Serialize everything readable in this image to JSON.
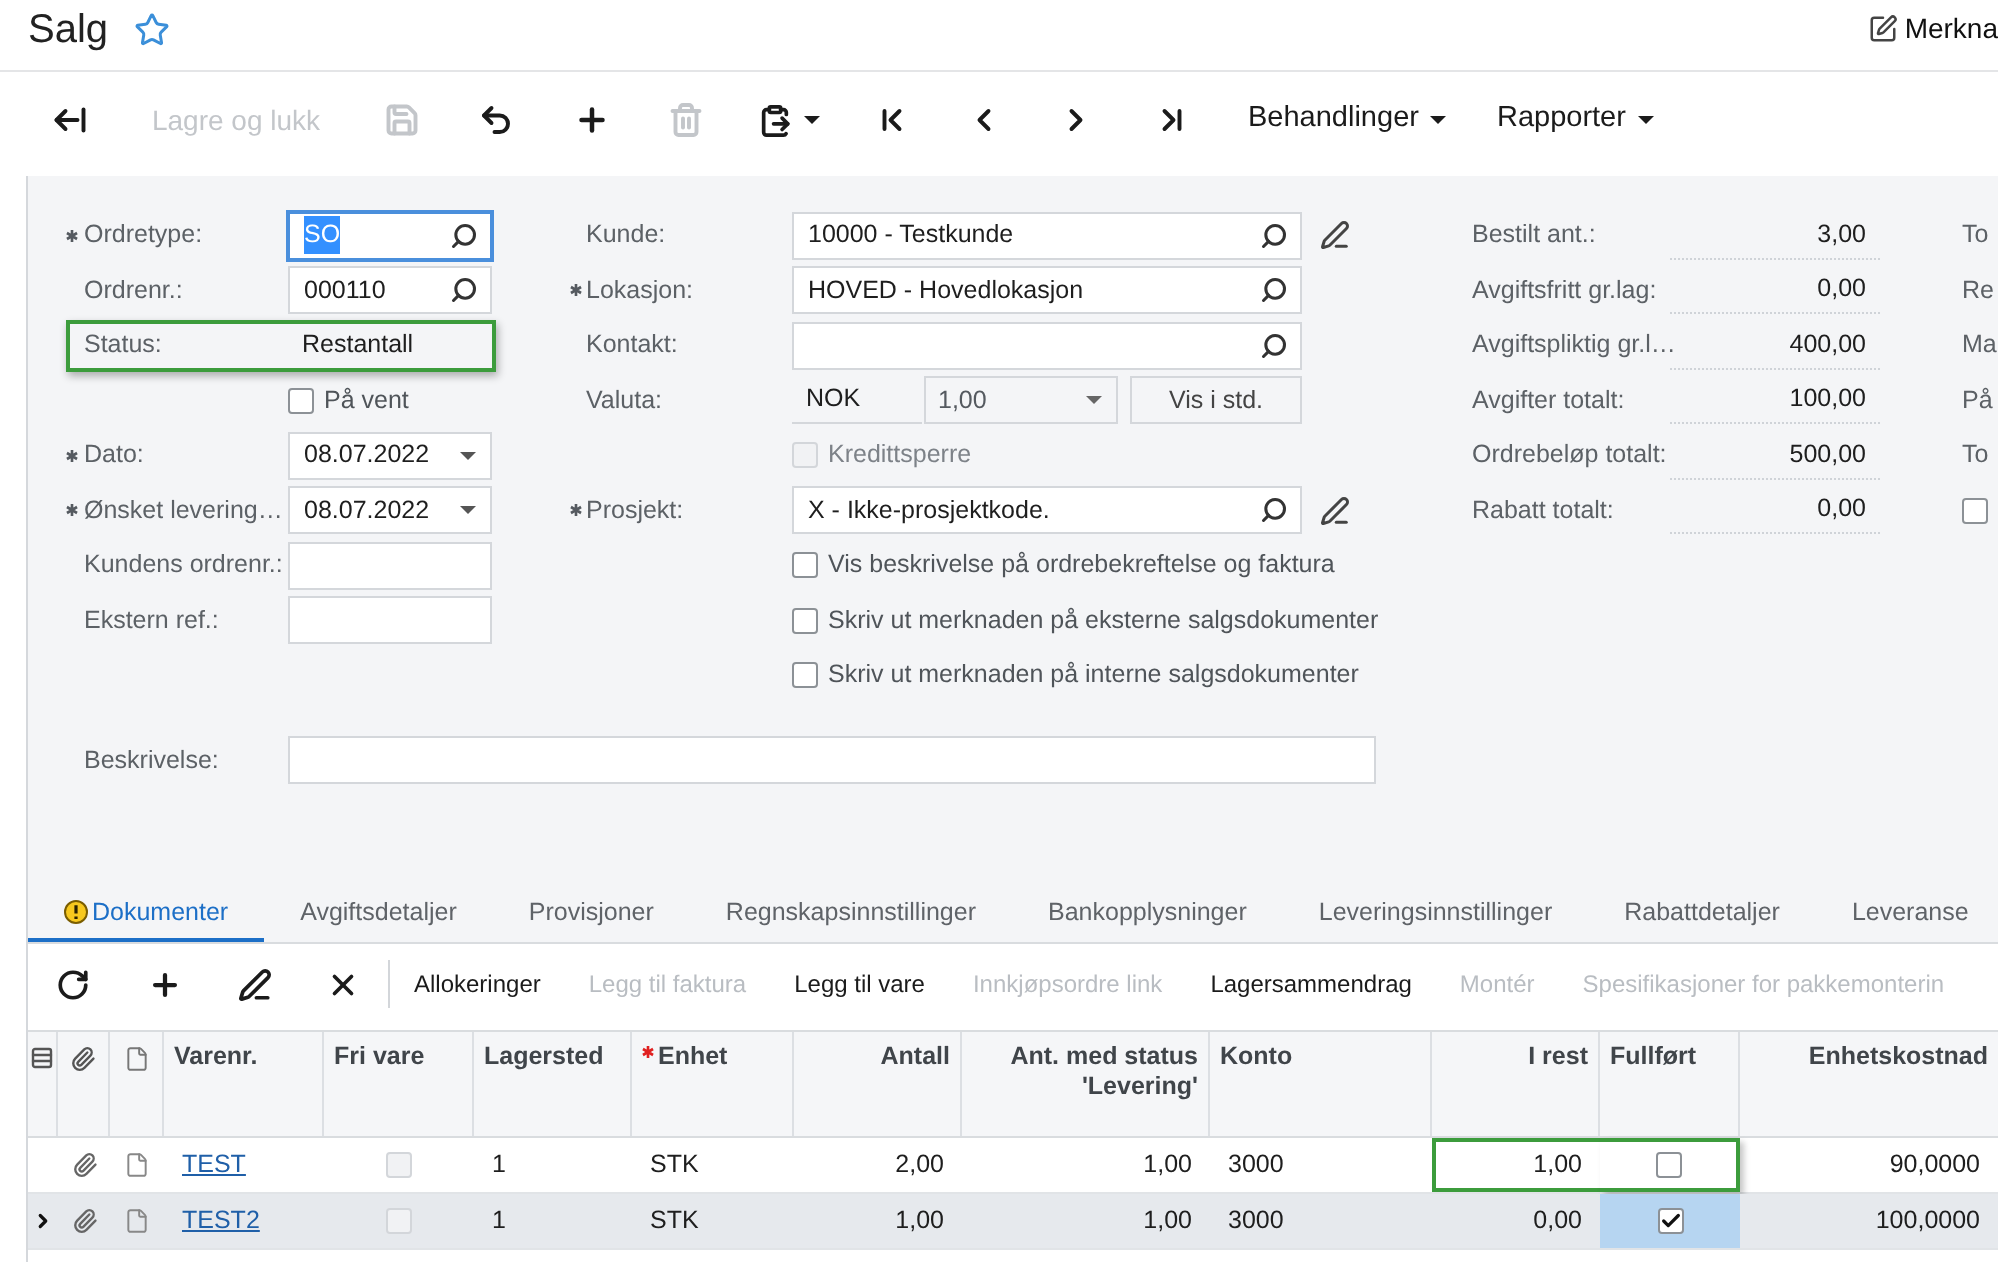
{
  "page": {
    "title": "Salg",
    "favorite": false,
    "notes_label": "Merkna"
  },
  "toolbar": [
    {
      "kind": "back",
      "disabled": false
    },
    {
      "kind": "text",
      "label": "Lagre og lukk",
      "disabled": true
    },
    {
      "kind": "save",
      "disabled": true
    },
    {
      "kind": "undo",
      "disabled": false
    },
    {
      "kind": "add",
      "disabled": false
    },
    {
      "kind": "delete",
      "disabled": true
    },
    {
      "kind": "paste",
      "disabled": false
    },
    {
      "kind": "first",
      "disabled": false
    },
    {
      "kind": "previous",
      "disabled": false
    },
    {
      "kind": "next",
      "disabled": false
    },
    {
      "kind": "last",
      "disabled": false
    },
    {
      "kind": "menu",
      "label": "Behandlinger",
      "disabled": false
    },
    {
      "kind": "menu",
      "label": "Rapporter",
      "disabled": false
    }
  ],
  "form": {
    "left": [
      {
        "kind": "lookup",
        "label": "Ordretype:",
        "required": true,
        "value": "SO",
        "focused": true,
        "highlighted": false
      },
      {
        "kind": "lookup",
        "label": "Ordrenr.:",
        "required": false,
        "value": "000110",
        "focused": false,
        "highlighted": false
      },
      {
        "kind": "readonly",
        "label": "Status:",
        "required": false,
        "value": "Restantall",
        "highlighted": true
      },
      {
        "kind": "checkbox",
        "label": "På vent",
        "checked": false,
        "disabled": false
      },
      {
        "kind": "date",
        "label": "Dato:",
        "required": true,
        "value": "08.07.2022",
        "focused": false,
        "highlighted": false
      },
      {
        "kind": "date",
        "label": "Ønsket levering…",
        "required": true,
        "value": "08.07.2022",
        "focused": false,
        "highlighted": false
      },
      {
        "kind": "text",
        "label": "Kundens ordrenr.:",
        "required": false,
        "focused": false,
        "highlighted": false
      },
      {
        "kind": "text",
        "label": "Ekstern ref.:",
        "required": false,
        "focused": false,
        "highlighted": false
      }
    ],
    "middle": [
      {
        "kind": "lookup",
        "label": "Kunde:",
        "required": false,
        "value": "10000 - Testkunde",
        "edit_button": true
      },
      {
        "kind": "lookup",
        "label": "Lokasjon:",
        "required": true,
        "value": "HOVED - Hovedlokasjon",
        "edit_button": false
      },
      {
        "kind": "lookup",
        "label": "Kontakt:",
        "required": false,
        "edit_button": false
      },
      {
        "kind": "currency",
        "label": "Valuta:",
        "required": false,
        "currency": "NOK",
        "rate": "1,00",
        "button": "Vis i std."
      },
      {
        "kind": "checkbox",
        "label": "Kredittsperre",
        "checked": false,
        "disabled": true
      },
      {
        "kind": "lookup",
        "label": "Prosjekt:",
        "required": true,
        "value": "X - Ikke-prosjektkode.",
        "edit_button": true
      },
      {
        "kind": "checkbox",
        "label": "Vis beskrivelse på ordrebekreftelse og faktura",
        "checked": false,
        "disabled": false
      },
      {
        "kind": "checkbox",
        "label": "Skriv ut merknaden på eksterne salgsdokumenter",
        "checked": false,
        "disabled": false
      },
      {
        "kind": "checkbox",
        "label": "Skriv ut merknaden på interne salgsdokumenter",
        "checked": false,
        "disabled": false
      }
    ],
    "totals": [
      {
        "label": "Bestilt ant.:",
        "value": "3,00"
      },
      {
        "label": "Avgiftsfritt gr.lag:",
        "value": "0,00"
      },
      {
        "label": "Avgiftspliktig gr.l…",
        "value": "400,00"
      },
      {
        "label": "Avgifter totalt:",
        "value": "100,00"
      },
      {
        "label": "Ordrebeløp totalt:",
        "value": "500,00"
      },
      {
        "label": "Rabatt totalt:",
        "value": "0,00"
      }
    ],
    "extra": [
      {
        "kind": "label",
        "label": "To"
      },
      {
        "kind": "label",
        "label": "Re"
      },
      {
        "kind": "label",
        "label": "Ma"
      },
      {
        "kind": "label",
        "label": "På"
      },
      {
        "kind": "label",
        "label": "To"
      },
      {
        "kind": "checkbox",
        "checked": false
      }
    ],
    "description": {
      "label": "Beskrivelse:"
    }
  },
  "tabs": [
    {
      "label": "Dokumenter",
      "selected": true,
      "warning": true
    },
    {
      "label": "Avgiftsdetaljer",
      "selected": false,
      "warning": false
    },
    {
      "label": "Provisjoner",
      "selected": false,
      "warning": false
    },
    {
      "label": "Regnskapsinnstillinger",
      "selected": false,
      "warning": false
    },
    {
      "label": "Bankopplysninger",
      "selected": false,
      "warning": false
    },
    {
      "label": "Leveringsinnstillinger",
      "selected": false,
      "warning": false
    },
    {
      "label": "Rabattdetaljer",
      "selected": false,
      "warning": false
    },
    {
      "label": "Leveranse",
      "selected": false,
      "warning": false
    }
  ],
  "grid_toolbar": [
    {
      "kind": "refresh",
      "disabled": false
    },
    {
      "kind": "add",
      "disabled": false
    },
    {
      "kind": "edit",
      "disabled": false
    },
    {
      "kind": "delete",
      "disabled": false
    },
    {
      "kind": "text",
      "label": "Allokeringer",
      "disabled": false
    },
    {
      "kind": "text",
      "label": "Legg til faktura",
      "disabled": true
    },
    {
      "kind": "text",
      "label": "Legg til vare",
      "disabled": false
    },
    {
      "kind": "text",
      "label": "Innkjøpsordre link",
      "disabled": true
    },
    {
      "kind": "text",
      "label": "Lagersammendrag",
      "disabled": false
    },
    {
      "kind": "text",
      "label": "Montér",
      "disabled": true
    },
    {
      "kind": "text",
      "label": "Spesifikasjoner for pakkemonterin",
      "disabled": true
    }
  ],
  "grid": {
    "columns": [
      {
        "label": "Varenr.",
        "kind": "link",
        "required": false
      },
      {
        "label": "Fri vare",
        "kind": "check",
        "required": false
      },
      {
        "label": "Lagersted",
        "kind": "text",
        "required": false
      },
      {
        "label": "Enhet",
        "kind": "text",
        "required": true
      },
      {
        "label": "Antall",
        "kind": "number",
        "required": false
      },
      {
        "label": "Ant. med status 'Levering'",
        "kind": "number",
        "required": false
      },
      {
        "label": "Konto",
        "kind": "text",
        "required": false
      },
      {
        "label": "I rest",
        "kind": "number",
        "required": false
      },
      {
        "label": "Fullført",
        "kind": "check",
        "required": false
      },
      {
        "label": "Enhetskostnad",
        "kind": "number",
        "required": false
      }
    ],
    "rows": [
      {
        "selected": false,
        "cells": [
          {
            "text": "TEST"
          },
          {
            "checked": false,
            "disabled": true
          },
          {
            "text": "1"
          },
          {
            "text": "STK"
          },
          {
            "text": "2,00"
          },
          {
            "text": "1,00"
          },
          {
            "text": "3000"
          },
          {
            "text": "1,00",
            "highlighted": true
          },
          {
            "checked": false,
            "disabled": false,
            "highlighted": true
          },
          {
            "text": "90,0000"
          }
        ]
      },
      {
        "selected": true,
        "cells": [
          {
            "text": "TEST2"
          },
          {
            "checked": false,
            "disabled": true
          },
          {
            "text": "1"
          },
          {
            "text": "STK"
          },
          {
            "text": "1,00"
          },
          {
            "text": "1,00"
          },
          {
            "text": "3000"
          },
          {
            "text": "0,00"
          },
          {
            "checked": true,
            "disabled": false,
            "focused": true
          },
          {
            "text": "100,0000"
          }
        ]
      }
    ]
  }
}
